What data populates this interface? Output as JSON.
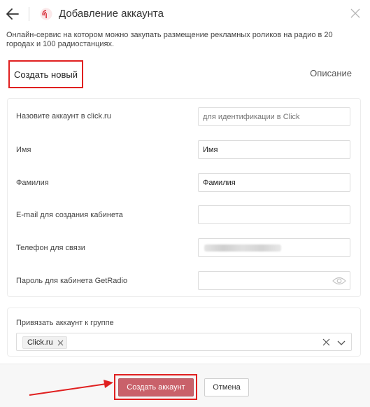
{
  "header": {
    "title": "Добавление аккаунта",
    "description": "Онлайн-сервис на котором можно закупать размещение рекламных роликов на радио в 20 городах и 100 радиостанциях."
  },
  "tabs": {
    "create_new": "Создать новый",
    "description": "Описание"
  },
  "form": {
    "account_name": {
      "label": "Назовите аккаунт в click.ru",
      "value": "",
      "placeholder": "для идентификации в Click"
    },
    "first_name": {
      "label": "Имя",
      "value": "Имя"
    },
    "last_name": {
      "label": "Фамилия",
      "value": "Фамилия"
    },
    "email": {
      "label": "E-mail для создания кабинета",
      "value": ""
    },
    "phone": {
      "label": "Телефон для связи"
    },
    "password": {
      "label": "Пароль для кабинета GetRadio",
      "value": ""
    }
  },
  "group": {
    "label": "Привязать аккаунт к группе",
    "selected_chip": "Click.ru"
  },
  "footer": {
    "create_button": "Создать аккаунт",
    "cancel_button": "Отмена"
  },
  "colors": {
    "accent_create": "#c9616a",
    "annotation_red": "#e02020"
  }
}
